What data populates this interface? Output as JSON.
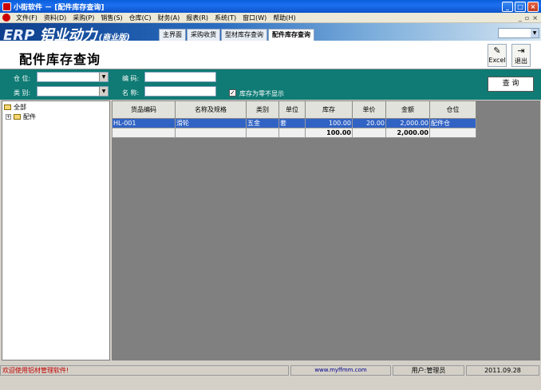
{
  "window": {
    "title": "小街软件 － [配件库存查询]",
    "controls": [
      "_",
      "□",
      "×"
    ]
  },
  "menu": {
    "items": [
      "文件(F)",
      "资料(D)",
      "采购(P)",
      "销售(S)",
      "仓库(C)",
      "财务(A)",
      "报表(R)",
      "系统(T)",
      "窗口(W)",
      "帮助(H)"
    ],
    "mdi_controls": [
      "_",
      "▫",
      "×"
    ]
  },
  "banner": {
    "logo_erp": "ERP",
    "logo_name": "铝业动力",
    "logo_edition": "(商业版)",
    "tabs": [
      "主界面",
      "采购收货",
      "型材库存查询",
      "配件库存查询"
    ],
    "active_tab": 3
  },
  "page": {
    "title": "配件库存查询"
  },
  "toolbar": {
    "excel_label": "Excel",
    "exit_label": "退出"
  },
  "filter": {
    "warehouse_label": "仓 位:",
    "category_label": "类 别:",
    "code_label": "编 码:",
    "name_label": "名 称:",
    "zero_stock_label": "库存为零不显示",
    "zero_stock_checked": true,
    "query_label": "查 询",
    "warehouse_value": "",
    "category_value": "",
    "code_value": "",
    "name_value": ""
  },
  "tree": {
    "root": "全部",
    "children": [
      "配件"
    ]
  },
  "grid": {
    "columns": [
      "货品编码",
      "名称及规格",
      "类别",
      "单位",
      "库存",
      "单价",
      "金额",
      "仓位"
    ],
    "rows": [
      [
        "HL-001",
        "滑轮",
        "五金",
        "套",
        "100.00",
        "20.00",
        "2,000.00",
        "配件仓"
      ]
    ],
    "totals": [
      "",
      "",
      "",
      "",
      "100.00",
      "",
      "2,000.00",
      ""
    ]
  },
  "status": {
    "welcome": "欢迎使用铝材管理软件!",
    "website": "www.myffmm.com",
    "user": "用户:管理员",
    "date": "2011.09.28"
  }
}
